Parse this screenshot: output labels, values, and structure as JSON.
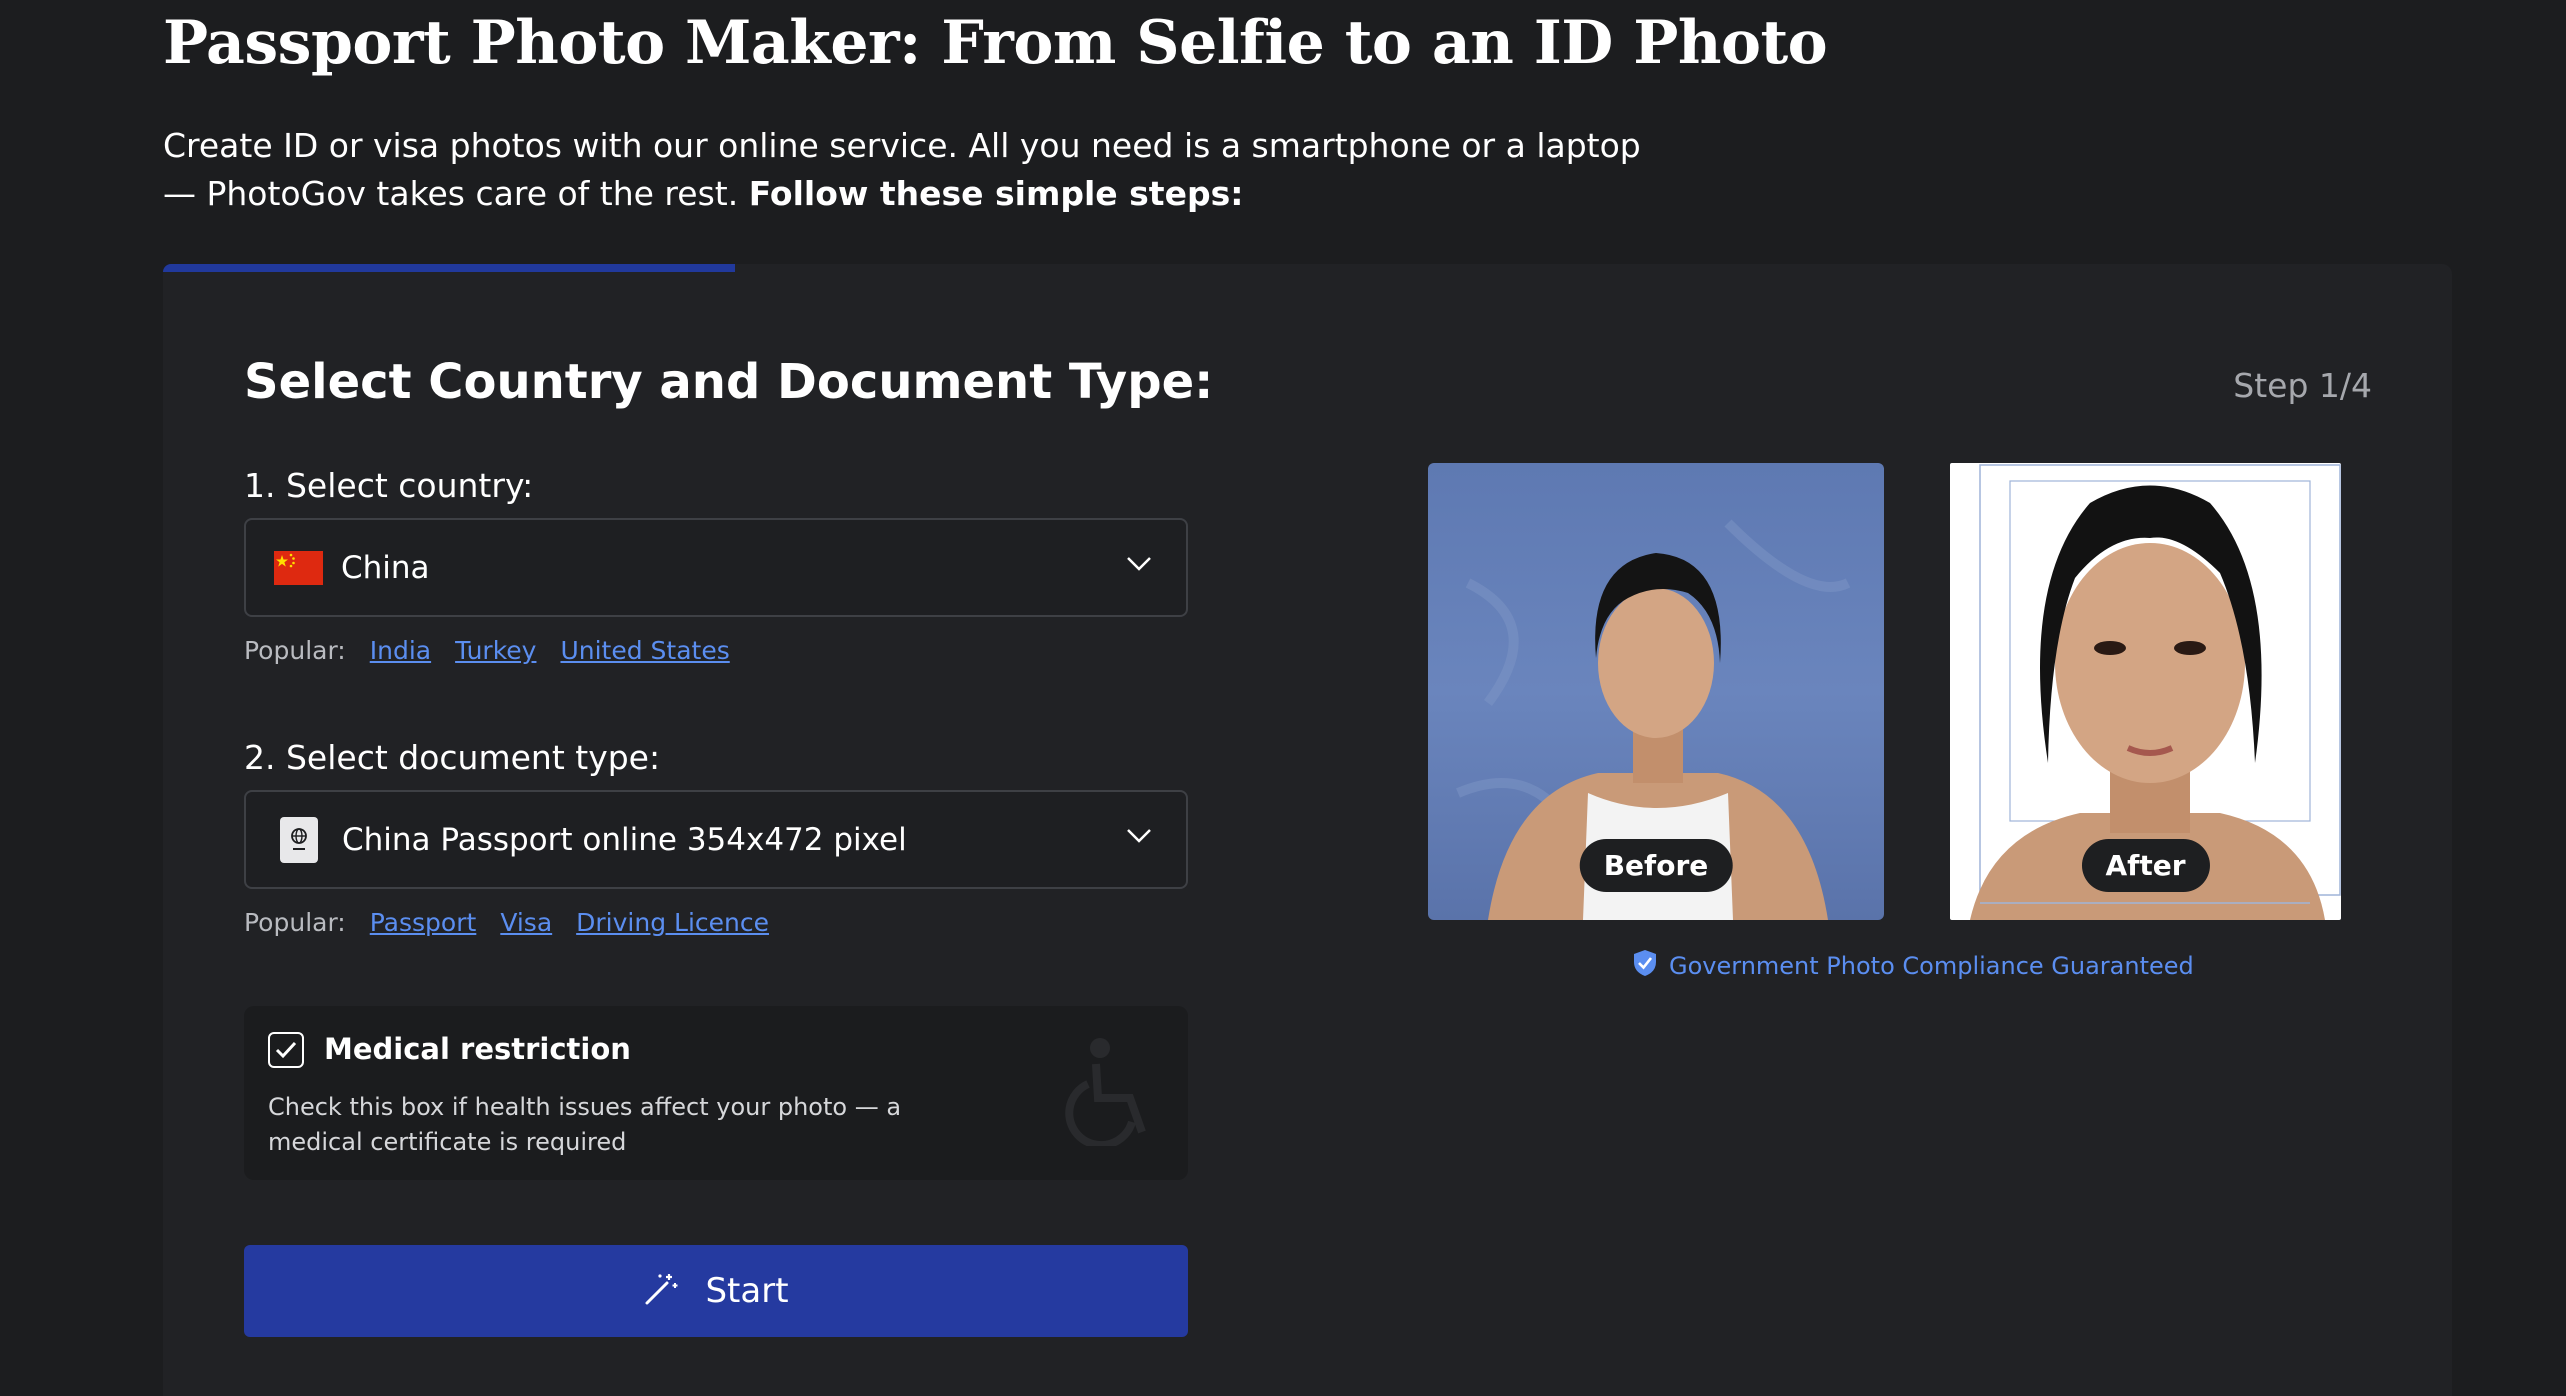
{
  "header": {
    "title": "Passport Photo Maker: From Selfie to an ID Photo",
    "intro_text": "Create ID or visa photos with our online service. All you need is a smartphone or a laptop — PhotoGov takes care of the rest.",
    "intro_bold": "Follow these simple steps:"
  },
  "wizard": {
    "progress_fraction": 0.25,
    "title": "Select Country and Document Type:",
    "step": "Step 1/4",
    "country": {
      "label": "1. Select country:",
      "value": "China",
      "popular_label": "Popular:",
      "popular": [
        "India",
        "Turkey",
        "United States"
      ]
    },
    "document": {
      "label": "2. Select document type:",
      "value": "China Passport online 354x472 pixel",
      "popular_label": "Popular:",
      "popular": [
        "Passport",
        "Visa",
        "Driving Licence"
      ]
    },
    "medical": {
      "checked": true,
      "title": "Medical restriction",
      "description": "Check this box if health issues affect your photo — a medical certificate is required"
    },
    "start_label": "Start"
  },
  "preview": {
    "before_label": "Before",
    "after_label": "After",
    "compliance_text": "Government Photo Compliance Guaranteed"
  },
  "colors": {
    "background": "#1c1d1f",
    "card": "#212225",
    "accent": "#253aa0",
    "link": "#5b8ef0"
  }
}
